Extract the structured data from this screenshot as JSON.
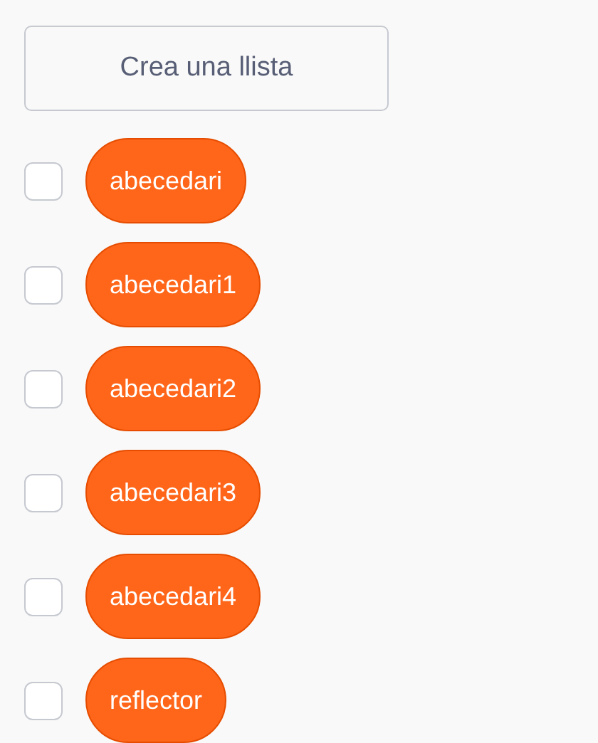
{
  "button": {
    "label": "Crea una llista"
  },
  "lists": [
    {
      "name": "abecedari",
      "checked": false
    },
    {
      "name": "abecedari1",
      "checked": false
    },
    {
      "name": "abecedari2",
      "checked": false
    },
    {
      "name": "abecedari3",
      "checked": false
    },
    {
      "name": "abecedari4",
      "checked": false
    },
    {
      "name": "reflector",
      "checked": false
    }
  ]
}
